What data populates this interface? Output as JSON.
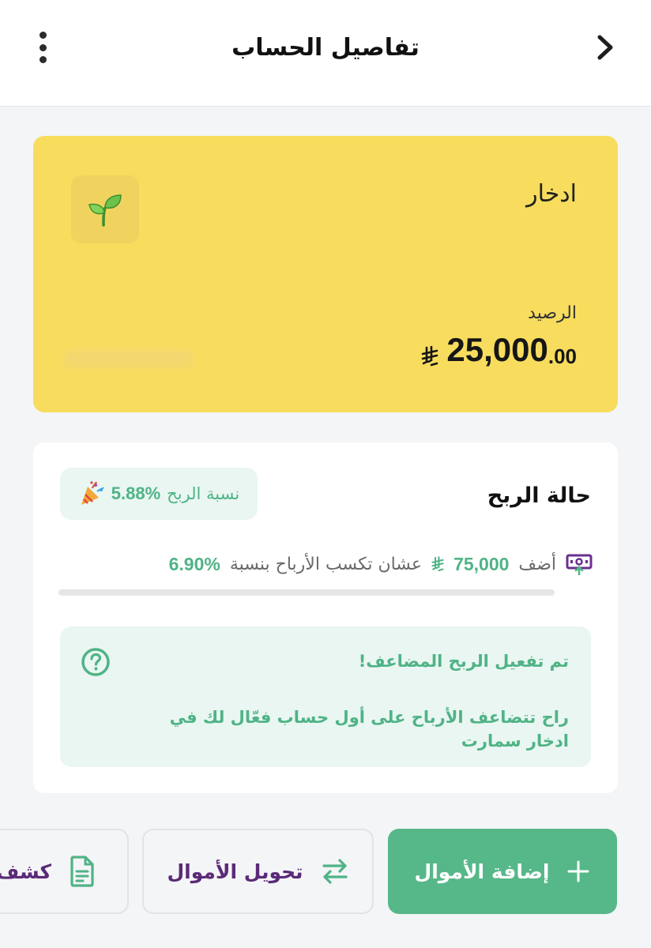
{
  "header": {
    "title": "تفاصيل الحساب"
  },
  "account": {
    "name": "ادخار",
    "balance_label": "الرصيد",
    "balance_main": "25,000",
    "balance_decimal": ".00"
  },
  "profit": {
    "title": "حالة الربح",
    "rate_label": "نسبة الربح",
    "rate_value": "5.88%",
    "tier_prefix": "أضف",
    "tier_amount": "75,000",
    "tier_suffix": "عشان تكسب الأرباح بنسبة",
    "tier_rate": "6.90%",
    "progress": 0.0,
    "info_title": "تم تفعيل الربح المضاعف!",
    "info_text": "راح تتضاعف الأرباح على أول حساب فعّال لك في ادخار سمارت"
  },
  "actions": {
    "add_label": "إضافة الأموال",
    "transfer_label": "تحويل الأموال",
    "statement_label": "كشف"
  },
  "colors": {
    "card_yellow": "#f7dc5e",
    "accent_green": "#56b889",
    "accent_purple": "#5b2a78"
  },
  "icons": {
    "back": "chevron-right-icon",
    "more": "more-vertical-icon",
    "plant": "seedling-icon",
    "party": "party-popper-icon",
    "cash": "cash-up-icon",
    "help": "help-circle-icon",
    "add": "plus-icon",
    "transfer": "transfer-arrows-icon",
    "statement": "document-icon"
  }
}
